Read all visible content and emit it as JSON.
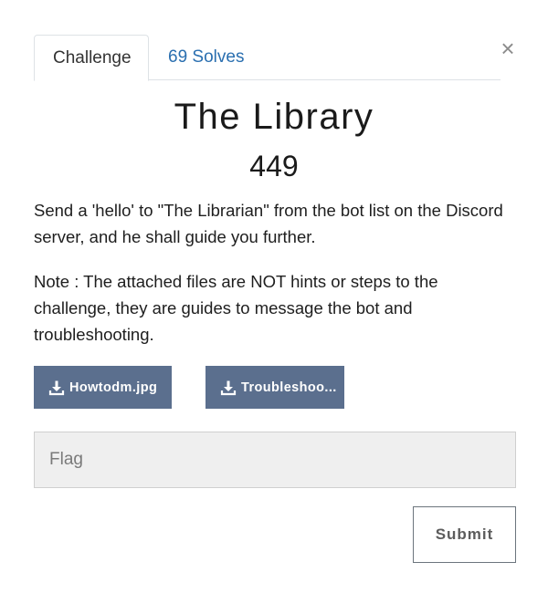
{
  "tabs": [
    {
      "label": "Challenge",
      "active": true
    },
    {
      "label": "69 Solves",
      "active": false
    }
  ],
  "close_label": "×",
  "challenge": {
    "name": "The Library",
    "points": "449",
    "description": [
      "Send a 'hello' to \"The Librarian\" from the bot list on the Discord server, and he shall guide you further.",
      "Note : The attached files are NOT hints or steps to the challenge, they are guides to message the bot and troubleshooting."
    ]
  },
  "files": [
    {
      "label": "Howtodm.jpg",
      "icon": "download-icon"
    },
    {
      "label": "Troubleshoo...",
      "icon": "download-icon"
    }
  ],
  "flag_input": {
    "placeholder": "Flag",
    "value": ""
  },
  "submit_label": "Submit",
  "colors": {
    "link": "#2a6fb0",
    "file_button": "#5b6f8e",
    "input_bg": "#efefef"
  }
}
